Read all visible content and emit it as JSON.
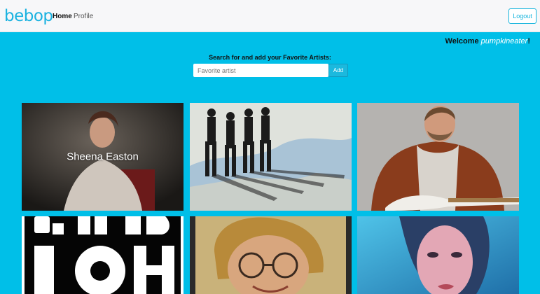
{
  "nav": {
    "brand": "bebop",
    "links": [
      {
        "label": "Home",
        "active": true
      },
      {
        "label": "Profile",
        "active": false
      }
    ],
    "logout_label": "Logout"
  },
  "welcome": {
    "prefix": "Welcome",
    "username": "pumpkineater",
    "suffix": "!"
  },
  "search": {
    "label": "Search for and add your Favorite Artists:",
    "placeholder": "Favorite artist",
    "button_label": "Add"
  },
  "artists": [
    {
      "name": "Sheena Easton",
      "label_visible": true
    },
    {
      "name": "",
      "label_visible": false
    },
    {
      "name": "",
      "label_visible": false
    },
    {
      "name": "",
      "label_visible": false
    },
    {
      "name": "",
      "label_visible": false
    },
    {
      "name": "",
      "label_visible": false
    }
  ],
  "colors": {
    "background": "#00bfe8",
    "accent": "#14b4dd"
  }
}
